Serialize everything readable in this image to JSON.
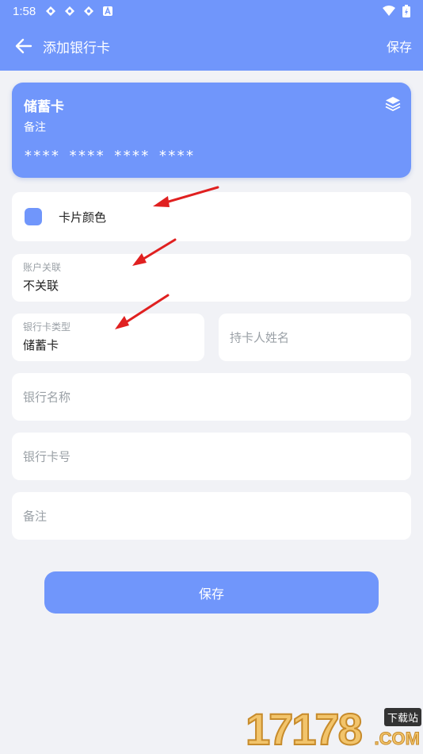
{
  "status_bar": {
    "time": "1:58",
    "icons": [
      "app-icon",
      "app-icon",
      "app-icon",
      "a-icon"
    ],
    "right_icons": [
      "wifi-icon",
      "battery-icon"
    ]
  },
  "toolbar": {
    "title": "添加银行卡",
    "save_label": "保存"
  },
  "card_preview": {
    "type": "储蓄卡",
    "note": "备注",
    "number": "**** **** **** ****",
    "icon": "layers-icon",
    "color": "#7096fb"
  },
  "form": {
    "card_color_label": "卡片颜色",
    "account_link": {
      "label": "账户关联",
      "value": "不关联"
    },
    "card_type": {
      "label": "银行卡类型",
      "value": "储蓄卡"
    },
    "holder_name": {
      "placeholder": "持卡人姓名"
    },
    "bank_name": {
      "placeholder": "银行名称"
    },
    "card_number": {
      "placeholder": "银行卡号"
    },
    "note": {
      "placeholder": "备注"
    }
  },
  "save_button": {
    "label": "保存"
  },
  "watermark": {
    "number": "17178",
    "tag": "下载站",
    "domain": ".COM"
  },
  "colors": {
    "accent": "#7096fb",
    "annotation_arrow": "#e02020",
    "background": "#f1f2f6"
  }
}
